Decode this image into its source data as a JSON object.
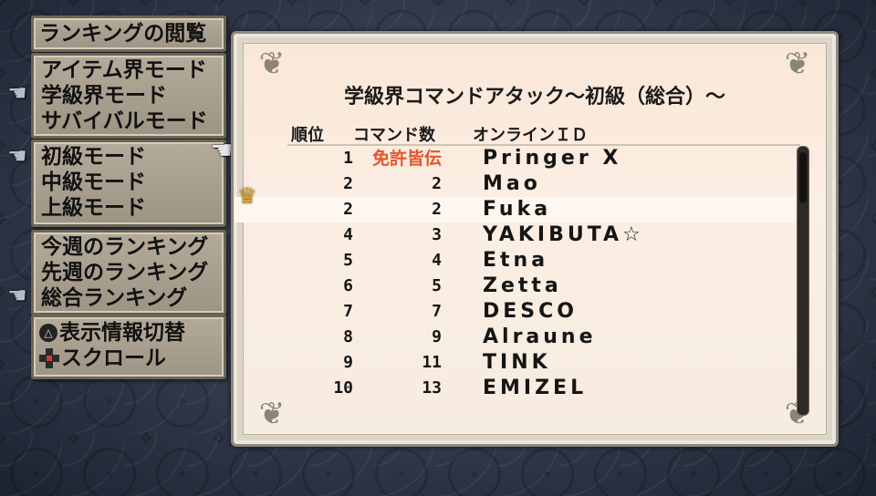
{
  "menu": {
    "title": "ランキングの閲覧",
    "modes": [
      "アイテム界モード",
      "学級界モード",
      "サバイバルモード"
    ],
    "levels": [
      "初級モード",
      "中級モード",
      "上級モード"
    ],
    "periods": [
      "今週のランキング",
      "先週のランキング",
      "総合ランキング"
    ],
    "help": {
      "toggle_label": "表示情報切替",
      "scroll_label": "スクロール"
    }
  },
  "board": {
    "title": "学級界コマンドアタック～初級（総合）～",
    "headers": {
      "rank": "順位",
      "commands": "コマンド数",
      "online_id": "オンラインＩＤ"
    },
    "rows": [
      {
        "rank": "1",
        "commands": "免許皆伝",
        "id": "Pringer X",
        "special": true
      },
      {
        "rank": "2",
        "commands": "2",
        "id": "Mao"
      },
      {
        "rank": "2",
        "commands": "2",
        "id": "Fuka",
        "highlight": true
      },
      {
        "rank": "4",
        "commands": "3",
        "id": "YAKIBUTA☆"
      },
      {
        "rank": "5",
        "commands": "4",
        "id": "Etna"
      },
      {
        "rank": "6",
        "commands": "5",
        "id": "Zetta"
      },
      {
        "rank": "7",
        "commands": "7",
        "id": "DESCO"
      },
      {
        "rank": "8",
        "commands": "9",
        "id": "Alraune"
      },
      {
        "rank": "9",
        "commands": "11",
        "id": "TINK"
      },
      {
        "rank": "10",
        "commands": "13",
        "id": "EMIZEL"
      }
    ]
  },
  "colors": {
    "special_text": "#e2552a",
    "highlight_row": "#fdf7f0",
    "crown": "#d7a13a"
  },
  "icons": {
    "pointer": "pointing-hand-icon",
    "crown": "crown-icon",
    "triangle_button": "triangle-button-icon",
    "dpad": "dpad-icon"
  }
}
